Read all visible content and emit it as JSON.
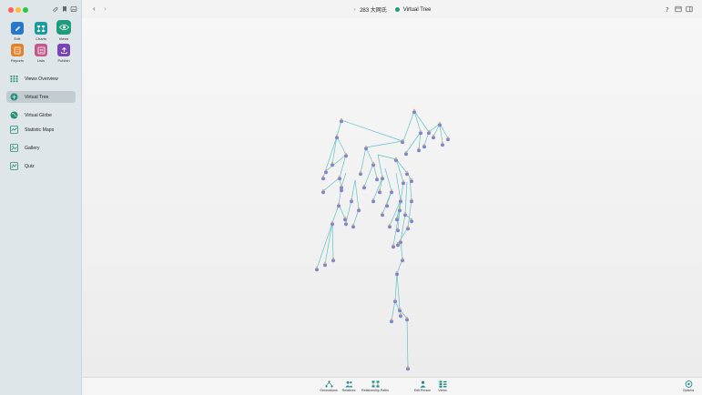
{
  "toolbar_buttons": [
    {
      "label": "Edit",
      "color": "#2a78c8"
    },
    {
      "label": "Charts",
      "color": "#1a9ba0"
    },
    {
      "label": "Views",
      "color": "#1f9c7c"
    },
    {
      "label": "Reports",
      "color": "#e0832c"
    },
    {
      "label": "Lists",
      "color": "#c2598e"
    },
    {
      "label": "Publish",
      "color": "#7b43b8"
    }
  ],
  "sidebar": {
    "items": [
      {
        "label": "Views Overview",
        "icon": "grid-icon"
      },
      {
        "label": "Virtual Tree",
        "icon": "tree-icon",
        "active": true
      },
      {
        "label": "Virtual Globe",
        "icon": "globe-icon"
      },
      {
        "label": "Statistic Maps",
        "icon": "map-icon"
      },
      {
        "label": "Gallery",
        "icon": "gallery-icon"
      },
      {
        "label": "Quiz",
        "icon": "quiz-icon"
      }
    ]
  },
  "header": {
    "person": "283 大网氏",
    "view_title": "Virtual Tree"
  },
  "bottom_toolbar": [
    {
      "label": "Generations",
      "icon": "generations-icon"
    },
    {
      "label": "Relatives",
      "icon": "relatives-icon"
    },
    {
      "label": "Relationship Paths",
      "icon": "relationship-paths-icon"
    },
    {
      "label": "Edit Person",
      "icon": "edit-person-icon"
    },
    {
      "label": "Views",
      "icon": "views-icon"
    },
    {
      "label": "Options",
      "icon": "options-icon"
    }
  ],
  "colors": {
    "accent": "#1f9c7c",
    "tree_line": "#5fc3c8",
    "node": "#7f86c9"
  }
}
